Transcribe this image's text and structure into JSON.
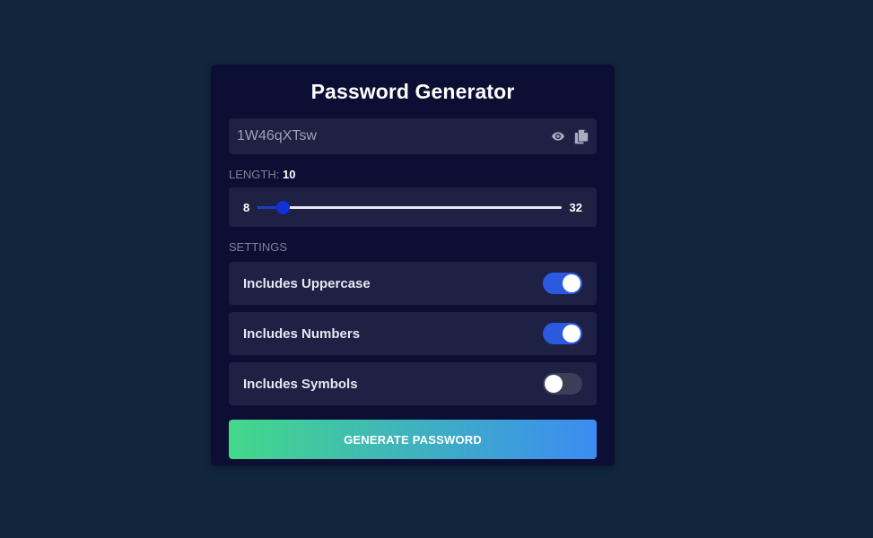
{
  "app": {
    "title": "Password Generator"
  },
  "password": {
    "value": "1W46qXTsw"
  },
  "icons": {
    "show": "eye-icon",
    "copy": "copy-icon"
  },
  "length": {
    "label": "Length:",
    "value": "10",
    "min": "8",
    "max": "32",
    "current": 10
  },
  "settings": {
    "label": "Settings",
    "options": [
      {
        "label": "Includes Uppercase",
        "enabled": true
      },
      {
        "label": "Includes Numbers",
        "enabled": true
      },
      {
        "label": "Includes Symbols",
        "enabled": false
      }
    ]
  },
  "generate": {
    "label": "GENERATE PASSWORD"
  },
  "colors": {
    "background": "#11263a",
    "card": "#0c0e33",
    "panel": "#1e2044",
    "toggle_on": "#2b5ae0",
    "toggle_off": "#3a3f57",
    "gradient_start": "#43d88a",
    "gradient_end": "#3b8cf2"
  }
}
